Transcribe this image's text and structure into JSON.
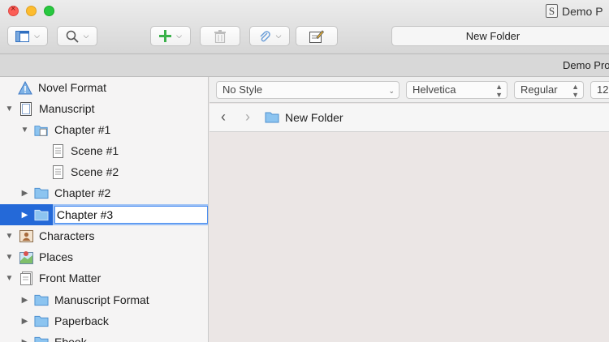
{
  "window": {
    "title": "Demo P"
  },
  "toolbar": {
    "document_title": "New Folder"
  },
  "header": {
    "project_label": "Demo Pro"
  },
  "binder": {
    "items": [
      {
        "label": "Novel Format",
        "icon": "warning-icon",
        "expanded": null
      },
      {
        "label": "Manuscript",
        "icon": "manuscript-icon",
        "expanded": true
      },
      {
        "label": "Chapter #1",
        "icon": "folder-docs-icon",
        "expanded": true
      },
      {
        "label": "Scene #1",
        "icon": "document-icon",
        "expanded": null
      },
      {
        "label": "Scene #2",
        "icon": "document-icon",
        "expanded": null
      },
      {
        "label": "Chapter #2",
        "icon": "folder-icon",
        "expanded": false
      },
      {
        "label": "Chapter #3",
        "icon": "folder-icon",
        "expanded": false,
        "selected": true,
        "editing": true
      },
      {
        "label": "Characters",
        "icon": "characters-icon",
        "expanded": true
      },
      {
        "label": "Places",
        "icon": "places-icon",
        "expanded": true
      },
      {
        "label": "Front Matter",
        "icon": "front-matter-icon",
        "expanded": true
      },
      {
        "label": "Manuscript Format",
        "icon": "folder-icon",
        "expanded": false
      },
      {
        "label": "Paperback",
        "icon": "folder-icon",
        "expanded": false
      },
      {
        "label": "Ebook",
        "icon": "folder-icon",
        "expanded": false
      }
    ]
  },
  "format_bar": {
    "style": "No Style",
    "font": "Helvetica",
    "weight": "Regular",
    "size": "12"
  },
  "nav": {
    "title": "New Folder"
  },
  "colors": {
    "selection": "#2469d8",
    "folder": "#8cc4f0",
    "add_green": "#3bb14a"
  }
}
